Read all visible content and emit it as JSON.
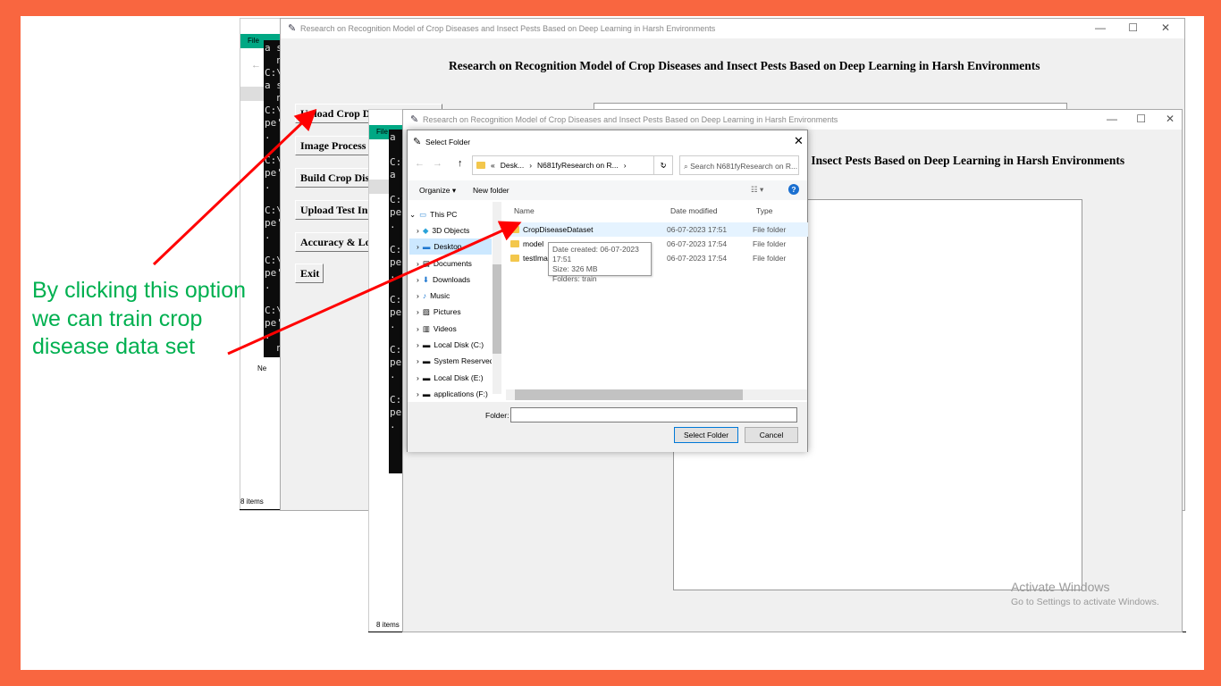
{
  "app_title": "Research on Recognition Model of Crop Diseases and Insect Pests Based on Deep Learning in Harsh Environments",
  "heading": "Research on Recognition Model of Crop Diseases and Insect Pests Based on Deep Learning in Harsh Environments",
  "heading_partial": "nd Insect Pests Based on Deep Learning in Harsh Environments",
  "explorer": {
    "menu_label": "File",
    "status": "8 items",
    "network_label": "Ne"
  },
  "console_lines": "a s\n  n\nC:\\\na s\n  n\nC:\\\npe'\n.\n\nC:\\\npe'\n.\n\nC:\\\npe'\n.\n\nC:\\\npe'\n.\n\nC:\\\npe'\n.\n  n",
  "app_buttons": [
    "Upload Crop D",
    "Image Process",
    "Build Crop Dis",
    "Upload Test In",
    "Accuracy & Lo",
    "Exit"
  ],
  "dialog": {
    "title": "Select Folder",
    "breadcrumb": [
      "Desk...",
      "N681fyResearch on R..."
    ],
    "search_placeholder": "Search N681fyResearch on R...",
    "organize": "Organize",
    "new_folder": "New folder",
    "tree": [
      "This PC",
      "3D Objects",
      "Desktop",
      "Documents",
      "Downloads",
      "Music",
      "Pictures",
      "Videos",
      "Local Disk (C:)",
      "System Reserved",
      "Local Disk (E:)",
      "applications (F:)"
    ],
    "columns": [
      "Name",
      "Date modified",
      "Type"
    ],
    "files": [
      {
        "name": "CropDiseaseDataset",
        "date": "06-07-2023 17:51",
        "type": "File folder"
      },
      {
        "name": "model",
        "date": "06-07-2023 17:54",
        "type": "File folder"
      },
      {
        "name": "testIma",
        "date": "06-07-2023 17:54",
        "type": "File folder"
      }
    ],
    "tooltip": [
      "Date created: 06-07-2023 17:51",
      "Size: 326 MB",
      "Folders: train"
    ],
    "folder_label": "Folder:",
    "folder_value": "",
    "select_button": "Select Folder",
    "cancel_button": "Cancel"
  },
  "annotation": "By clicking this option we can train crop disease data set",
  "watermark": {
    "title": "Activate Windows",
    "subtitle": "Go to Settings to activate Windows."
  },
  "colors": {
    "background": "#F96640",
    "annotation": "#00B050",
    "arrow": "#FF0000",
    "explorer_ribbon": "#00A884"
  }
}
